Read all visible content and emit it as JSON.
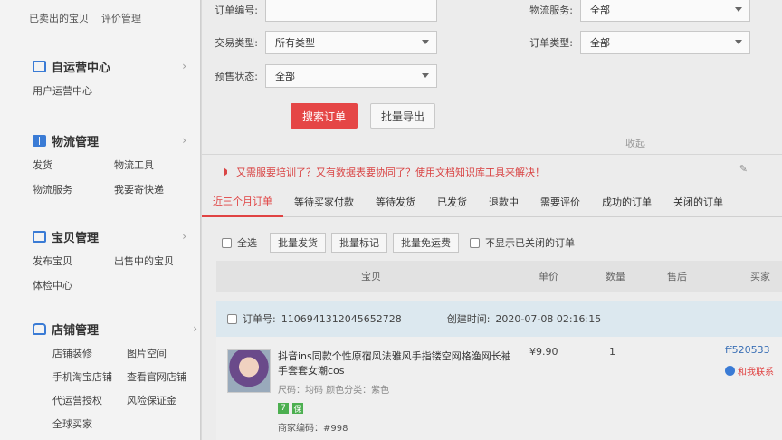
{
  "sidebar": {
    "top_links": [
      "已卖出的宝贝",
      "评价管理"
    ],
    "sections": [
      {
        "title": "自运营中心",
        "icon": "monitor-icon",
        "links": [
          "用户运营中心"
        ]
      },
      {
        "title": "物流管理",
        "icon": "book-icon",
        "links": [
          "发货",
          "物流工具",
          "物流服务",
          "我要寄快递"
        ]
      },
      {
        "title": "宝贝管理",
        "icon": "monitor-icon",
        "links": [
          "发布宝贝",
          "出售中的宝贝",
          "体检中心"
        ]
      },
      {
        "title": "店铺管理",
        "icon": "store-icon",
        "links": [
          "店铺装修",
          "图片空间",
          "手机淘宝店铺",
          "查看官网店铺",
          "代运营授权",
          "风险保证金",
          "全球买家"
        ]
      }
    ],
    "chevron": "›"
  },
  "filters": {
    "order_no_label": "订单编号:",
    "order_no_value": "",
    "logistics_label": "物流服务:",
    "logistics_value": "全部",
    "trade_type_label": "交易类型:",
    "trade_type_value": "所有类型",
    "order_type_label": "订单类型:",
    "order_type_value": "全部",
    "presale_label": "预售状态:",
    "presale_value": "全部"
  },
  "actions": {
    "search": "搜索订单",
    "export": "批量导出",
    "collapse": "收起"
  },
  "notice": "又需服要培训了？又有数据表要协同了？使用文档知识库工具来解决！",
  "tabs": [
    "近三个月订单",
    "等待买家付款",
    "等待发货",
    "已发货",
    "退款中",
    "需要评价",
    "成功的订单",
    "关闭的订单"
  ],
  "bulk": {
    "select_all": "全选",
    "ship": "批量发货",
    "mark": "批量标记",
    "free_shipping": "批量免运费",
    "hide_closed": "不显示已关闭的订单"
  },
  "table_headers": [
    "宝贝",
    "单价",
    "数量",
    "售后",
    "买家"
  ],
  "order": {
    "order_no_label": "订单号:",
    "order_no": "1106941312045652728",
    "created_label": "创建时间:",
    "created": "2020-07-08 02:16:15",
    "item_title": "抖音ins同款个性原宿风法雅风手指镂空网格渔网长袖手套套女潮cos",
    "item_attr": "尺码：均码  颜色分类：紫色",
    "badges": [
      "7",
      "保"
    ],
    "merchant_code": "商家编码：#998",
    "price": "¥9.90",
    "quantity": "1",
    "buyer": "ff520533",
    "contact": "和我联系"
  }
}
